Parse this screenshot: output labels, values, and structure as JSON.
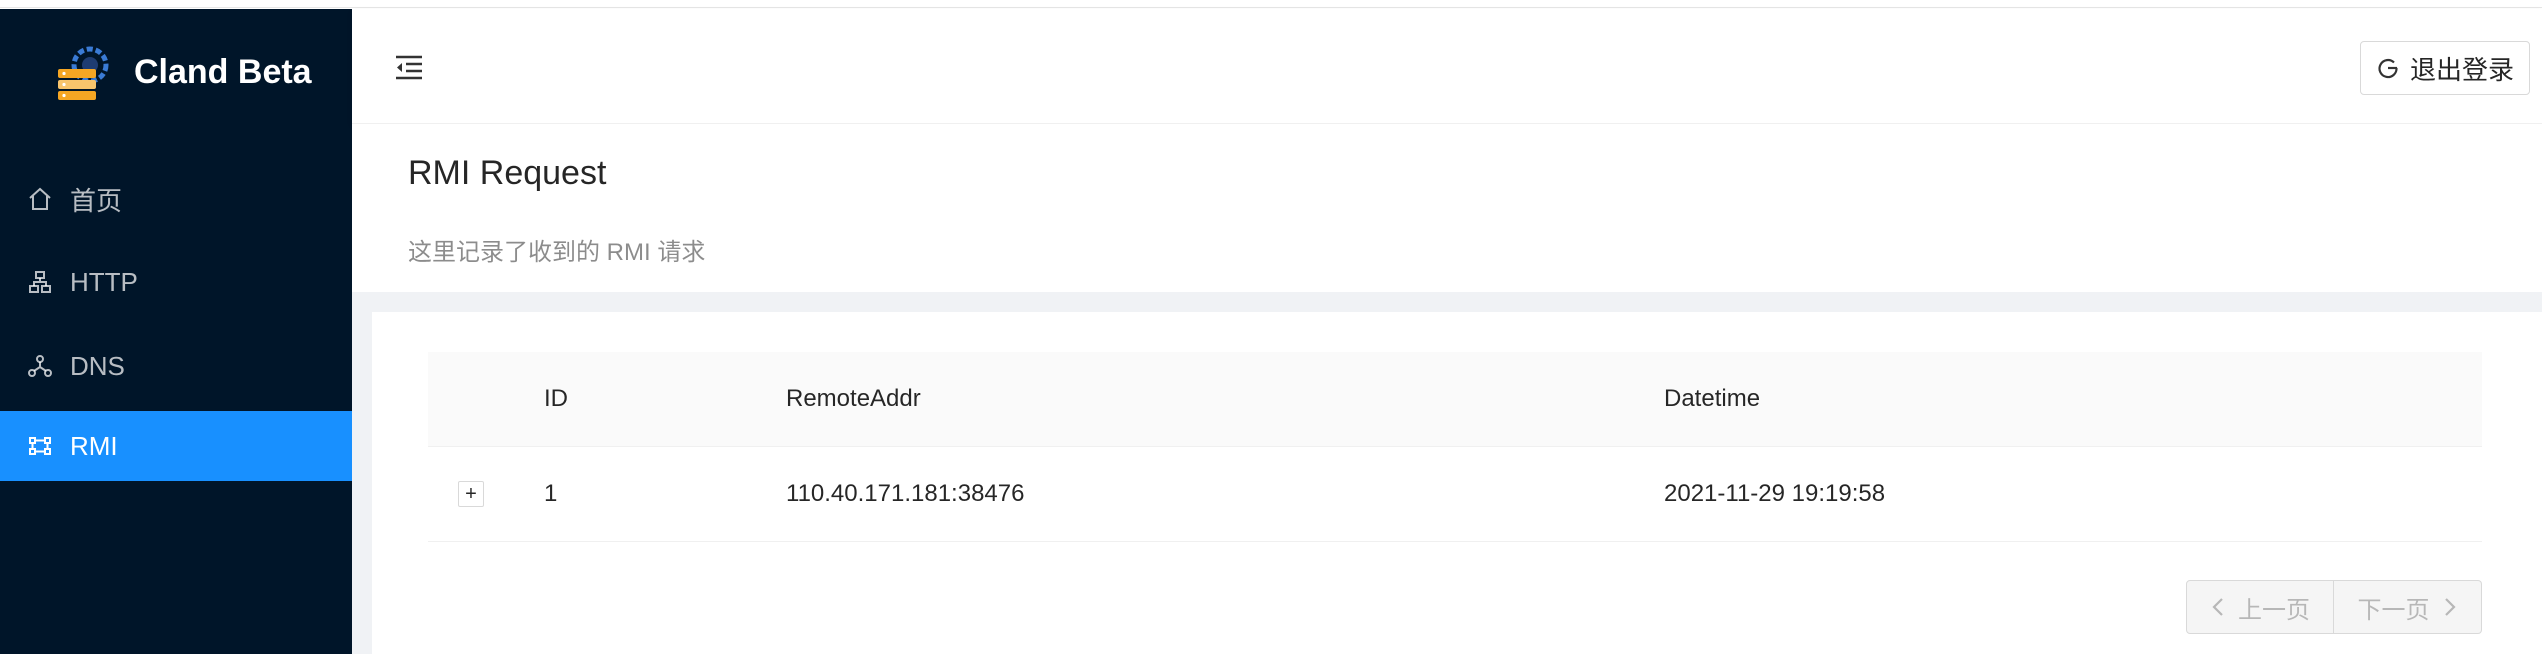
{
  "app": {
    "title": "Cland Beta",
    "colors": {
      "sidebar_bg": "#001529",
      "accent": "#1890ff"
    }
  },
  "sidebar": {
    "items": [
      {
        "label": "首页",
        "icon": "home-icon",
        "active": false
      },
      {
        "label": "HTTP",
        "icon": "cluster-icon",
        "active": false
      },
      {
        "label": "DNS",
        "icon": "deployment-unit-icon",
        "active": false
      },
      {
        "label": "RMI",
        "icon": "border-icon",
        "active": true
      }
    ]
  },
  "header": {
    "fold_icon": "menu-fold-icon",
    "logout_label": "退出登录",
    "logout_icon": "logout-icon"
  },
  "page": {
    "title": "RMI Request",
    "subtitle": "这里记录了收到的 RMI 请求"
  },
  "table": {
    "columns": [
      "ID",
      "RemoteAddr",
      "Datetime"
    ],
    "rows": [
      {
        "expand": "+",
        "id": "1",
        "remote_addr": "110.40.171.181:38476",
        "datetime": "2021-11-29 19:19:58"
      }
    ]
  },
  "pagination": {
    "prev_label": "上一页",
    "next_label": "下一页"
  }
}
